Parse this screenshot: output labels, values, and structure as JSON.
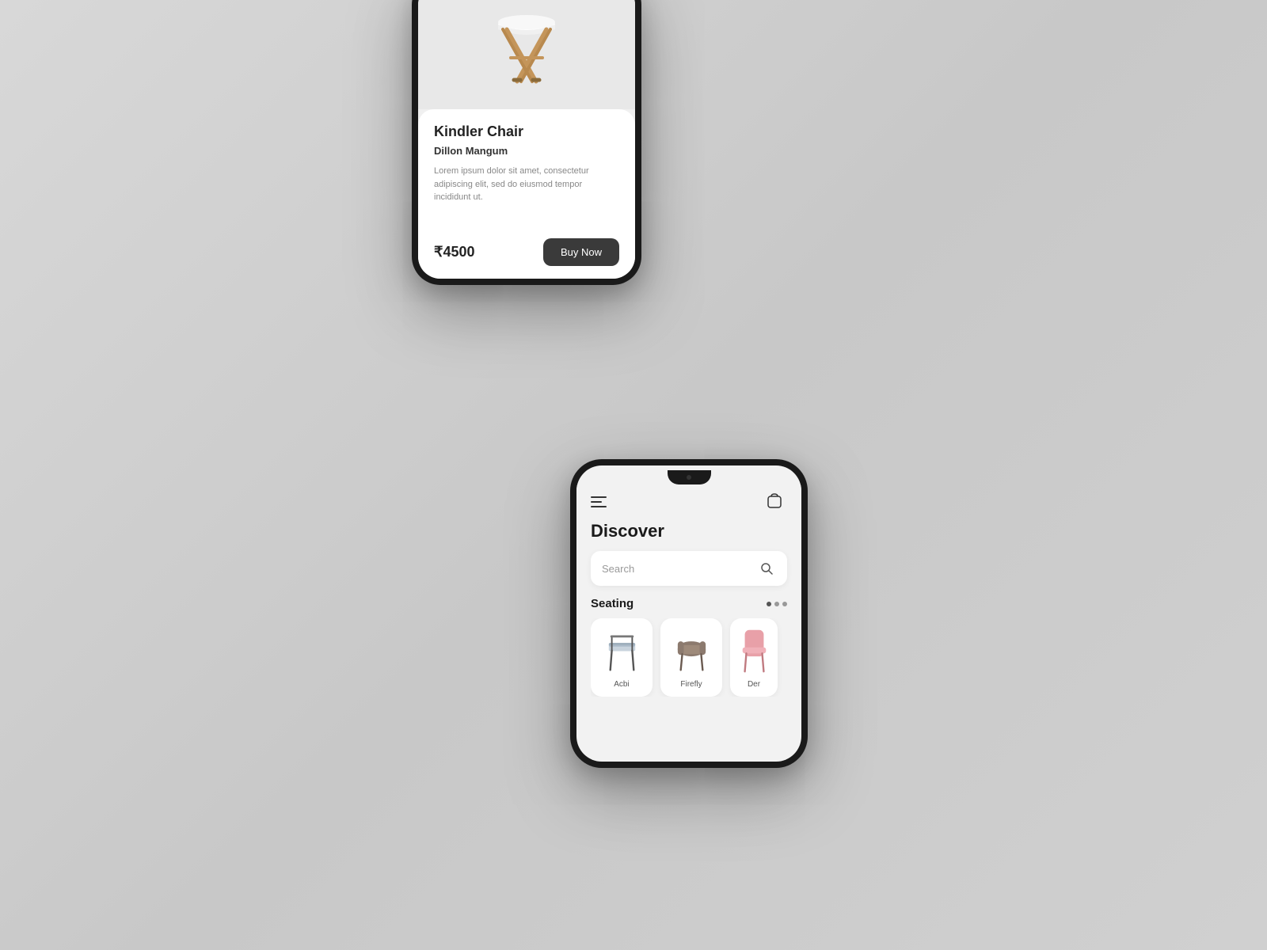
{
  "background": {
    "color": "#cccccc"
  },
  "phone1": {
    "product": {
      "title": "Kindler Chair",
      "author": "Dillon Mangum",
      "description": "Lorem ipsum dolor sit amet, consectetur adipiscing elit, sed do eiusmod tempor incididunt ut.",
      "price": "₹4500",
      "buy_button_label": "Buy Now"
    }
  },
  "phone2": {
    "header": {
      "title": "Discover"
    },
    "search": {
      "placeholder": "Search"
    },
    "seating_section": {
      "label": "Seating"
    },
    "products": [
      {
        "name": "Acbi",
        "color": "#b0b8c1"
      },
      {
        "name": "Firefly",
        "color": "#9e8a7a"
      },
      {
        "name": "Der",
        "color": "#e8a0a8"
      }
    ]
  }
}
